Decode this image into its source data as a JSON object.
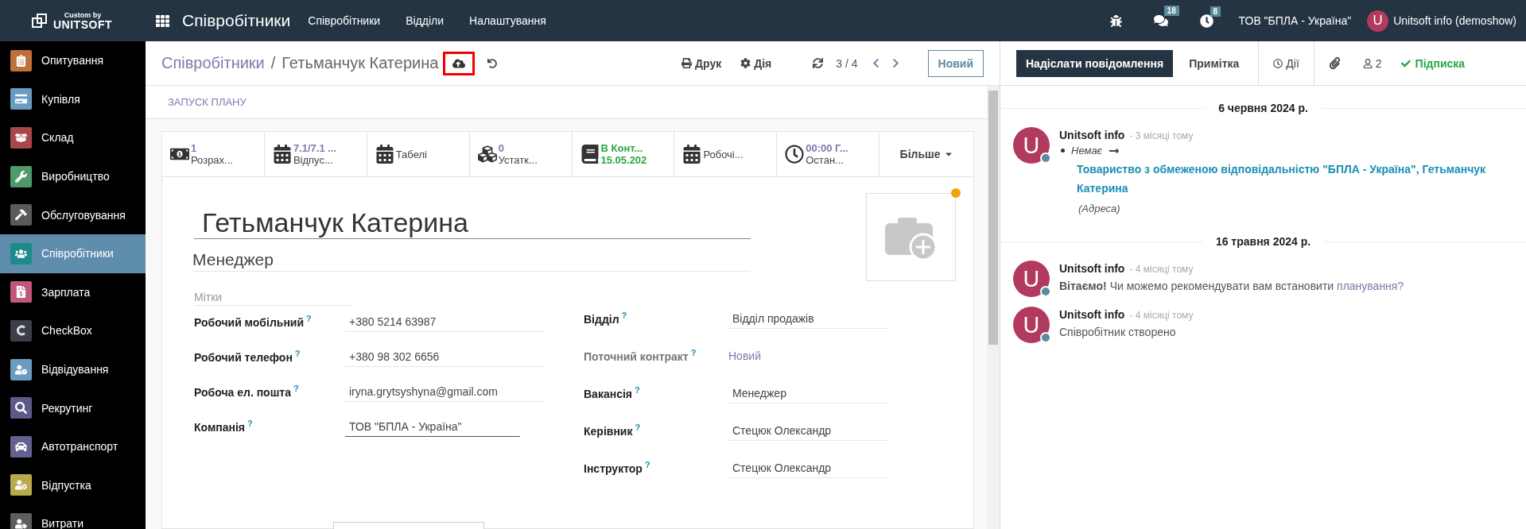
{
  "navbar": {
    "brand_top": "Custom by",
    "brand_bottom": "UNITSOFT",
    "app_title": "Співробітники",
    "menu": [
      "Співробітники",
      "Відділи",
      "Налаштування"
    ],
    "messages_count": "18",
    "activities_count": "8",
    "company": "ТОВ \"БПЛА - Україна\"",
    "user_initial": "U",
    "user_name": "Unitsoft info (demoshow)"
  },
  "sidebar": {
    "items": [
      {
        "label": "Опитування",
        "color": "#c0703a",
        "selected": false
      },
      {
        "label": "Купівля",
        "color": "#6a9cc0",
        "selected": false
      },
      {
        "label": "Склад",
        "color": "#a8484a",
        "selected": false
      },
      {
        "label": "Виробництво",
        "color": "#4f9a6a",
        "selected": false
      },
      {
        "label": "Обслуговування",
        "color": "#5a5a5a",
        "selected": false
      },
      {
        "label": "Співробітники",
        "color": "#1f8a8a",
        "selected": true
      },
      {
        "label": "Зарплата",
        "color": "#c0577a",
        "selected": false
      },
      {
        "label": "CheckBox",
        "color": "#3b3f47",
        "selected": false
      },
      {
        "label": "Відвідування",
        "color": "#6a9cc0",
        "selected": false
      },
      {
        "label": "Рекрутинг",
        "color": "#5d5a8a",
        "selected": false
      },
      {
        "label": "Автотранспорт",
        "color": "#62628e",
        "selected": false
      },
      {
        "label": "Відпустка",
        "color": "#b8aa4a",
        "selected": false
      },
      {
        "label": "Витрати",
        "color": "#5e5e5e",
        "selected": false
      }
    ]
  },
  "control_panel": {
    "breadcrumb_parent": "Співробітники",
    "breadcrumb_separator": "/",
    "breadcrumb_current": "Гетьманчук Катерина",
    "print": "Друк",
    "action": "Дія",
    "pager": "3 / 4",
    "new_button": "Новий"
  },
  "statusbar": {
    "button": "ЗАПУСК ПЛАНУ"
  },
  "button_box": [
    {
      "kind": "stat",
      "value": "1",
      "label": "Розрах...",
      "color": "#7c7bad"
    },
    {
      "kind": "stat",
      "value": "7.1/7.1 ...",
      "label": "Відпус...",
      "color": "#7c7bad"
    },
    {
      "kind": "plain",
      "label": "Табелі"
    },
    {
      "kind": "stat",
      "value": "0",
      "label": "Устатк...",
      "color": "#7c7bad"
    },
    {
      "kind": "stat",
      "value": "В Конт...",
      "label": "15.05.202",
      "color": "#28a745"
    },
    {
      "kind": "plain",
      "label": "Робочі..."
    },
    {
      "kind": "stat",
      "value": "00:00 Г...",
      "label": "Остан...",
      "color": "#7c7bad"
    },
    {
      "kind": "more",
      "label": "Більше"
    }
  ],
  "form": {
    "name": "Гетьманчук Катерина",
    "job_title": "Менеджер",
    "tags_placeholder": "Мітки",
    "has_image_badge": true,
    "left_fields": [
      {
        "label": "Робочий мобільний",
        "help": "?",
        "value": "+380 5214 63987",
        "kind": "text",
        "muted": false
      },
      {
        "label": "Робочий телефон",
        "help": "?",
        "value": "+380 98 302 6656",
        "kind": "text",
        "muted": false
      },
      {
        "label": "Робоча ел. пошта",
        "help": "?",
        "value": "iryna.grytsyshyna@gmail.com",
        "kind": "text",
        "muted": false
      },
      {
        "label": "Компанія",
        "help": "?",
        "value": "ТОВ \"БПЛА - Україна\"",
        "kind": "select",
        "muted": false
      }
    ],
    "right_fields": [
      {
        "label": "Відділ",
        "help": "?",
        "value": "Відділ продажів",
        "kind": "text",
        "muted": false
      },
      {
        "label": "Поточний контракт",
        "help": "?",
        "value": "Новий",
        "kind": "link",
        "muted": true
      },
      {
        "label": "Вакансія",
        "help": "?",
        "value": "Менеджер",
        "kind": "text",
        "muted": false
      },
      {
        "label": "Керівник",
        "help": "?",
        "value": "Стецюк Олександр",
        "kind": "text",
        "muted": false
      },
      {
        "label": "Інструктор",
        "help": "?",
        "value": "Стецюк Олександр",
        "kind": "text",
        "muted": false
      }
    ]
  },
  "chatter": {
    "tabs": [
      {
        "label": "Надіслати повідомлення",
        "selected": true
      },
      {
        "label": "Примітка",
        "selected": false
      }
    ],
    "activities": "Дії",
    "followers": "2",
    "follow": "Підписка",
    "groups": [
      {
        "date": "6 червня 2024 р.",
        "messages": [
          {
            "kind": "tracking",
            "initial": "U",
            "author": "Unitsoft info",
            "time": "- 3 місяці тому",
            "old_value": "Немає",
            "new_value": "Товариство з обмеженою відповідальністю \"БПЛА - Україна\", Гетьманчук Катерина",
            "field": "(Адреса)"
          }
        ]
      },
      {
        "date": "16 травня 2024 р.",
        "messages": [
          {
            "kind": "text",
            "initial": "U",
            "author": "Unitsoft info",
            "time": "- 4 місяці тому",
            "body": "**Вітаємо!** Чи можемо рекомендувати вам встановити",
            "link": "планування?"
          },
          {
            "kind": "text",
            "initial": "U",
            "author": "Unitsoft info",
            "time": "- 4 місяці тому",
            "body": "Співробітник створено"
          }
        ]
      }
    ]
  }
}
